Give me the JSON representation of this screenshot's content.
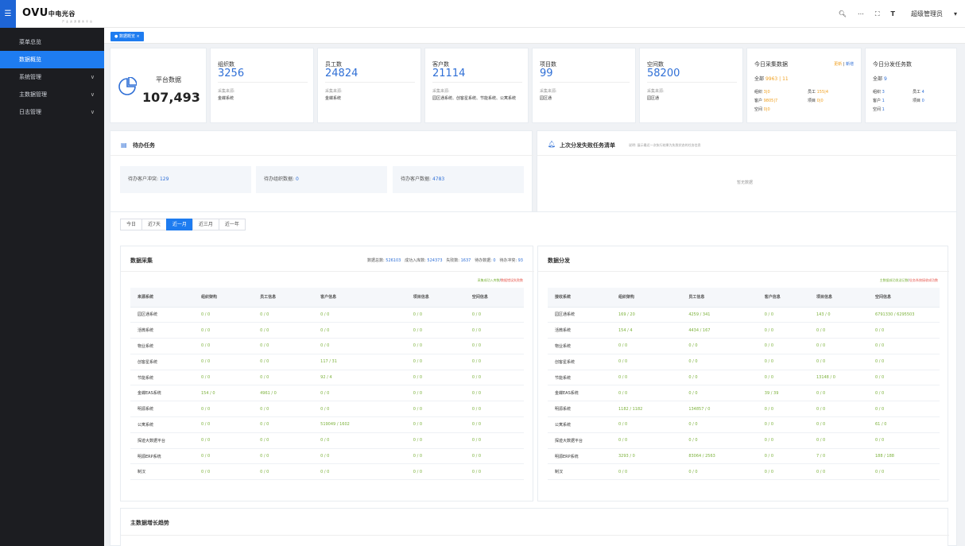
{
  "topbar": {
    "menu_icon": "hamburger-menu-icon",
    "logo_main": "OVU",
    "logo_cn": "中电光谷",
    "logo_sub": "产业资源服务平台",
    "user_name": "超级管理员"
  },
  "sidebar": {
    "items": [
      {
        "label": "菜单总览",
        "active": false,
        "has_children": false
      },
      {
        "label": "数据概览",
        "active": true,
        "has_children": false
      },
      {
        "label": "系统管理",
        "active": false,
        "has_children": true
      },
      {
        "label": "主数据管理",
        "active": false,
        "has_children": true
      },
      {
        "label": "日志管理",
        "active": false,
        "has_children": true
      }
    ]
  },
  "tabs": [
    {
      "label": "● 数据概览 ×"
    }
  ],
  "platform": {
    "label": "平台数据",
    "value": "107,493"
  },
  "stats": [
    {
      "label": "组织数",
      "value": "3256",
      "src_label": "采集来源:",
      "src": "金蝶系统"
    },
    {
      "label": "员工数",
      "value": "24824",
      "src_label": "采集来源:",
      "src": "金蝶系统"
    },
    {
      "label": "客户数",
      "value": "21114",
      "src_label": "采集来源:",
      "src": "园区通系统、创客星系统、节能系统、公寓系统"
    },
    {
      "label": "项目数",
      "value": "99",
      "src_label": "采集来源:",
      "src": "园区通"
    },
    {
      "label": "空间数",
      "value": "58200",
      "src_label": "采集来源:",
      "src": "园区通"
    }
  ],
  "today_collect": {
    "title": "今日采集数据",
    "legend_update": "更新",
    "legend_sep": "|",
    "legend_add": "新增",
    "all_label": "全部",
    "all_update": "9963",
    "all_add": "11",
    "org_label": "组织",
    "org_update": "3",
    "org_add": "0",
    "emp_label": "员工",
    "emp_update": "155",
    "emp_add": "4",
    "cust_label": "客户",
    "cust_update": "9805",
    "cust_add": "7",
    "proj_label": "项目",
    "proj_update": "0",
    "proj_add": "0",
    "space_label": "空间",
    "space_update": "0",
    "space_add": "0"
  },
  "today_dist": {
    "title": "今日分发任务数",
    "all_label": "全部",
    "all": "9",
    "org_label": "组织",
    "org": "3",
    "emp_label": "员工",
    "emp": "4",
    "cust_label": "客户",
    "cust": "1",
    "proj_label": "项目",
    "proj": "0",
    "space_label": "空间",
    "space": "1"
  },
  "todo": {
    "title": "待办任务",
    "items": [
      {
        "label": "待办客户冲突:",
        "value": "129"
      },
      {
        "label": "待办组织数据:",
        "value": "0"
      },
      {
        "label": "待办客户数据:",
        "value": "4783"
      }
    ]
  },
  "failed": {
    "title": "上次分发失败任务清单",
    "note": "说明: 展示最近一次执行结果为失败状态的任务信息",
    "empty": "暂无数据"
  },
  "periods": [
    {
      "label": "今日",
      "on": false
    },
    {
      "label": "近7天",
      "on": false
    },
    {
      "label": "近一月",
      "on": true
    },
    {
      "label": "近三月",
      "on": false
    },
    {
      "label": "近一年",
      "on": false
    }
  ],
  "collect": {
    "title": "数据采集",
    "summary": {
      "total_label": "数据总数:",
      "total": "526103",
      "ok_label": "成功入库数:",
      "ok": "524373",
      "fail_label": "失败数:",
      "fail": "1637",
      "pending_label": "待办数据:",
      "pending": "0",
      "conflict_label": "待办冲突:",
      "conflict": "93"
    },
    "legend_ok": "采集成功入库数",
    "legend_sep": "/",
    "legend_fail": "数据错误失败数",
    "headers": [
      "来源系统",
      "组织架构",
      "员工信息",
      "客户信息",
      "项目信息",
      "空间信息"
    ],
    "rows": [
      [
        "园区通系统",
        "0 / 0",
        "0 / 0",
        "0 / 0",
        "0 / 0",
        "0 / 0"
      ],
      [
        "活微系统",
        "0 / 0",
        "0 / 0",
        "0 / 0",
        "0 / 0",
        "0 / 0"
      ],
      [
        "物业系统",
        "0 / 0",
        "0 / 0",
        "0 / 0",
        "0 / 0",
        "0 / 0"
      ],
      [
        "创客星系统",
        "0 / 0",
        "0 / 0",
        "117 / 31",
        "0 / 0",
        "0 / 0"
      ],
      [
        "节能系统",
        "0 / 0",
        "0 / 0",
        "92 / 4",
        "0 / 0",
        "0 / 0"
      ],
      [
        "金蝶EAS系统",
        "154 / 0",
        "4961 / 0",
        "0 / 0",
        "0 / 0",
        "0 / 0"
      ],
      [
        "明源系统",
        "0 / 0",
        "0 / 0",
        "0 / 0",
        "0 / 0",
        "0 / 0"
      ],
      [
        "公寓系统",
        "0 / 0",
        "0 / 0",
        "519049 / 1602",
        "0 / 0",
        "0 / 0"
      ],
      [
        "探迹大数据平台",
        "0 / 0",
        "0 / 0",
        "0 / 0",
        "0 / 0",
        "0 / 0"
      ],
      [
        "明源ERP系统",
        "0 / 0",
        "0 / 0",
        "0 / 0",
        "0 / 0",
        "0 / 0"
      ],
      [
        "制汉",
        "0 / 0",
        "0 / 0",
        "0 / 0",
        "0 / 0",
        "0 / 0"
      ]
    ]
  },
  "dist": {
    "title": "数据分发",
    "legend_ok": "主数据成功发送记数",
    "legend_sep": "/",
    "legend_fail": "业务系统接收成功数",
    "headers": [
      "接收系统",
      "组织架构",
      "员工信息",
      "客户信息",
      "项目信息",
      "空间信息"
    ],
    "rows": [
      [
        "园区通系统",
        "169 / 20",
        "4259 / 341",
        "0 / 0",
        "143 / 0",
        "6791330 / 6295503"
      ],
      [
        "活微系统",
        "154 / 4",
        "4434 / 167",
        "0 / 0",
        "0 / 0",
        "0 / 0"
      ],
      [
        "物业系统",
        "0 / 0",
        "0 / 0",
        "0 / 0",
        "0 / 0",
        "0 / 0"
      ],
      [
        "创客星系统",
        "0 / 0",
        "0 / 0",
        "0 / 0",
        "0 / 0",
        "0 / 0"
      ],
      [
        "节能系统",
        "0 / 0",
        "0 / 0",
        "0 / 0",
        "13148 / 0",
        "0 / 0"
      ],
      [
        "金蝶EAS系统",
        "0 / 0",
        "0 / 0",
        "39 / 39",
        "0 / 0",
        "0 / 0"
      ],
      [
        "明源系统",
        "1182 / 1182",
        "134857 / 0",
        "0 / 0",
        "0 / 0",
        "0 / 0"
      ],
      [
        "公寓系统",
        "0 / 0",
        "0 / 0",
        "0 / 0",
        "0 / 0",
        "61 / 0"
      ],
      [
        "探迹大数据平台",
        "0 / 0",
        "0 / 0",
        "0 / 0",
        "0 / 0",
        "0 / 0"
      ],
      [
        "明源ERP系统",
        "3293 / 0",
        "83064 / 2563",
        "0 / 0",
        "7 / 0",
        "188 / 188"
      ],
      [
        "制汉",
        "0 / 0",
        "0 / 0",
        "0 / 0",
        "0 / 0",
        "0 / 0"
      ]
    ]
  },
  "trend": {
    "title": "主数据增长趋势"
  },
  "colors": {
    "accent": "#1e7cf0",
    "sidebar": "#1c1d21",
    "value_blue": "#2f6fd6",
    "value_green": "#7bb13a",
    "value_orange": "#f0a020",
    "fail_red": "#e6544a"
  }
}
